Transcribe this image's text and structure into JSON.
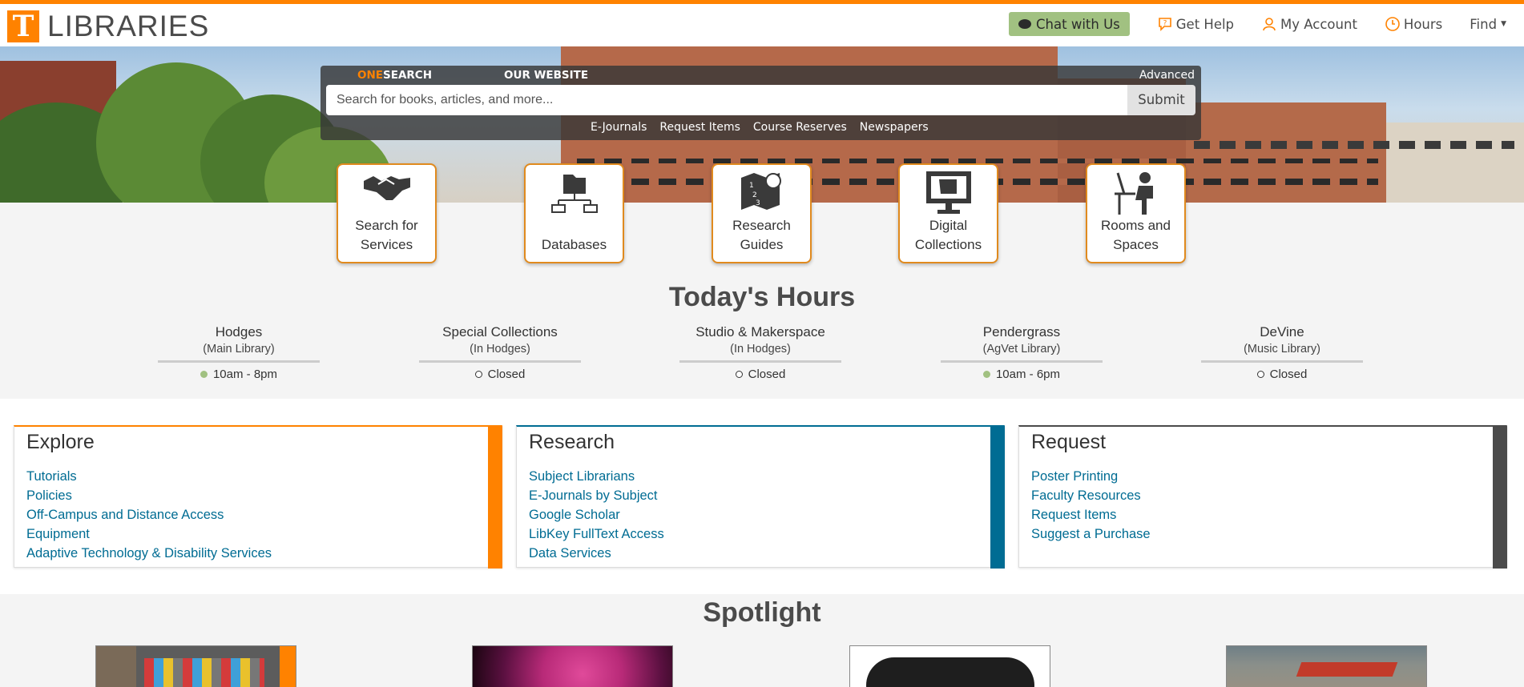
{
  "header": {
    "logo_letter": "T",
    "logo_text": "LIBRARIES",
    "chat_label": "Chat with Us",
    "help_label": "Get Help",
    "account_label": "My Account",
    "hours_label": "Hours",
    "find_label": "Find"
  },
  "search": {
    "tab_one_prefix": "ONE",
    "tab_one_suffix": "SEARCH",
    "tab_website": "OUR WEBSITE",
    "advanced": "Advanced",
    "placeholder": "Search for books, articles, and more...",
    "submit": "Submit",
    "quick_links": [
      "E-Journals",
      "Request Items",
      "Course Reserves",
      "Newspapers"
    ]
  },
  "tiles": [
    {
      "line1": "Search for",
      "line2": "Services",
      "icon": "handshake-icon"
    },
    {
      "line1": "",
      "line2": "Databases",
      "icon": "database-network-icon"
    },
    {
      "line1": "Research",
      "line2": "Guides",
      "icon": "guide-map-icon"
    },
    {
      "line1": "Digital",
      "line2": "Collections",
      "icon": "monitor-scroll-icon"
    },
    {
      "line1": "Rooms and",
      "line2": "Spaces",
      "icon": "person-at-desk-icon"
    }
  ],
  "hours": {
    "title": "Today's Hours",
    "locations": [
      {
        "name": "Hodges",
        "sub": "(Main Library)",
        "status": "10am - 8pm",
        "open": true
      },
      {
        "name": "Special Collections",
        "sub": "(In Hodges)",
        "status": "Closed",
        "open": false
      },
      {
        "name": "Studio & Makerspace",
        "sub": "(In Hodges)",
        "status": "Closed",
        "open": false
      },
      {
        "name": "Pendergrass",
        "sub": "(AgVet Library)",
        "status": "10am - 6pm",
        "open": true
      },
      {
        "name": "DeVine",
        "sub": "(Music Library)",
        "status": "Closed",
        "open": false
      }
    ]
  },
  "sections": {
    "explore": {
      "title": "Explore",
      "color": "#ff8200",
      "links": [
        "Tutorials",
        "Policies",
        "Off-Campus and Distance Access",
        "Equipment",
        "Adaptive Technology & Disability Services"
      ]
    },
    "research": {
      "title": "Research",
      "color": "#006c93",
      "links": [
        "Subject Librarians",
        "E-Journals by Subject",
        "Google Scholar",
        "LibKey FullText Access",
        "Data Services"
      ]
    },
    "request": {
      "title": "Request",
      "color": "#4b4b4b",
      "links": [
        "Poster Printing",
        "Faculty Resources",
        "Request Items",
        "Suggest a Purchase"
      ]
    }
  },
  "spotlight": {
    "title": "Spotlight"
  },
  "colors": {
    "brand_orange": "#ff8200",
    "link_blue": "#006c93",
    "chat_green": "#a1c181",
    "open_dot": "#a1c181"
  }
}
